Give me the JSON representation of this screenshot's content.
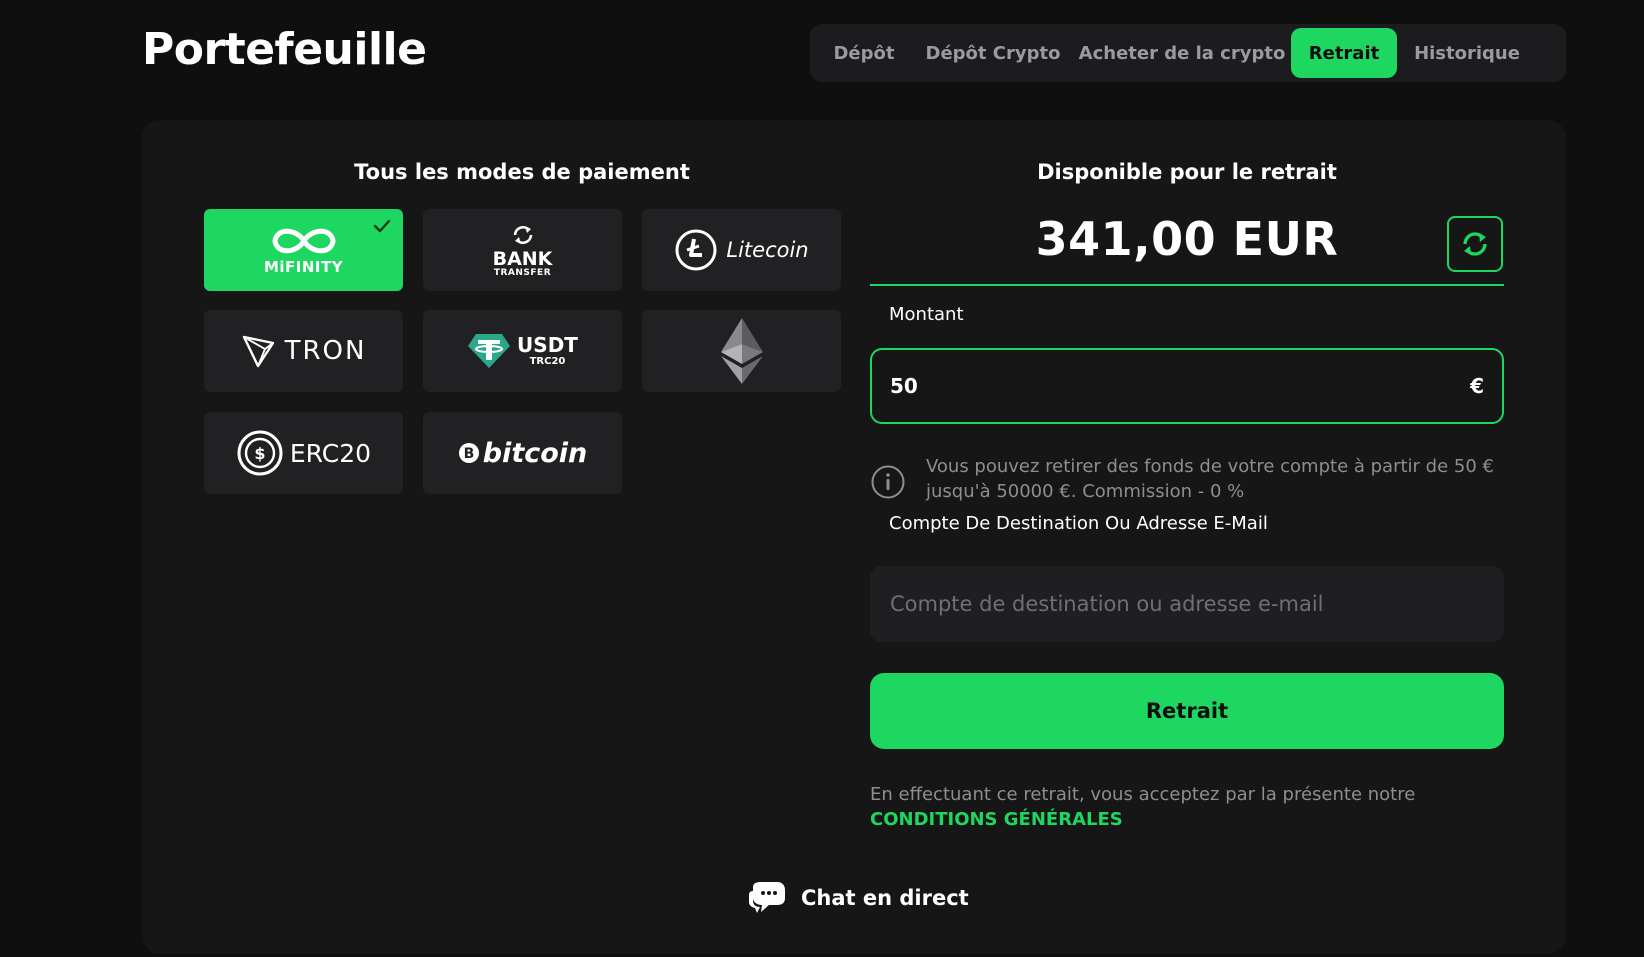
{
  "header": {
    "title": "Portefeuille",
    "tabs": [
      {
        "label": "Dépôt",
        "active": false
      },
      {
        "label": "Dépôt Crypto",
        "active": false
      },
      {
        "label": "Acheter de la crypto",
        "active": false
      },
      {
        "label": "Retrait",
        "active": true
      },
      {
        "label": "Historique",
        "active": false
      }
    ]
  },
  "payment_methods": {
    "title": "Tous les modes de paiement",
    "items": [
      {
        "name": "MiFINITY",
        "logo_text": "MiFINITY",
        "selected": true
      },
      {
        "name": "Bank Transfer",
        "logo_text": "BANK",
        "logo_subtext": "TRANSFER",
        "selected": false
      },
      {
        "name": "Litecoin",
        "logo_text": "Litecoin",
        "selected": false
      },
      {
        "name": "TRON",
        "logo_text": "TRON",
        "selected": false
      },
      {
        "name": "USDT TRC20",
        "logo_text": "USDT",
        "logo_subtext": "TRC20",
        "selected": false
      },
      {
        "name": "Ethereum",
        "icon": "ethereum-icon",
        "selected": false
      },
      {
        "name": "ERC20",
        "logo_text": "ERC20",
        "selected": false
      },
      {
        "name": "bitcoin",
        "logo_text": "bitcoin",
        "selected": false
      }
    ]
  },
  "withdrawal": {
    "available_label": "Disponible pour le retrait",
    "balance": "341,00 EUR",
    "amount_label": "Montant",
    "amount_value": "50",
    "currency_symbol": "€",
    "info_text": "Vous pouvez retirer des fonds de votre compte à partir de 50 € jusqu'à 50000 €. Commission - 0 %",
    "destination_label": "Compte De Destination Ou Adresse E-Mail",
    "destination_placeholder": "Compte de destination ou adresse e-mail",
    "submit_label": "Retrait",
    "terms_text": "En effectuant ce retrait, vous acceptez par la présente notre",
    "terms_link": "CONDITIONS GÉNÉRALES"
  },
  "chat": {
    "label": "Chat en direct"
  },
  "colors": {
    "accent": "#1ed760",
    "background": "#0f0f10",
    "card": "#161617",
    "tile": "#212123",
    "muted_text": "#8d8d92"
  }
}
